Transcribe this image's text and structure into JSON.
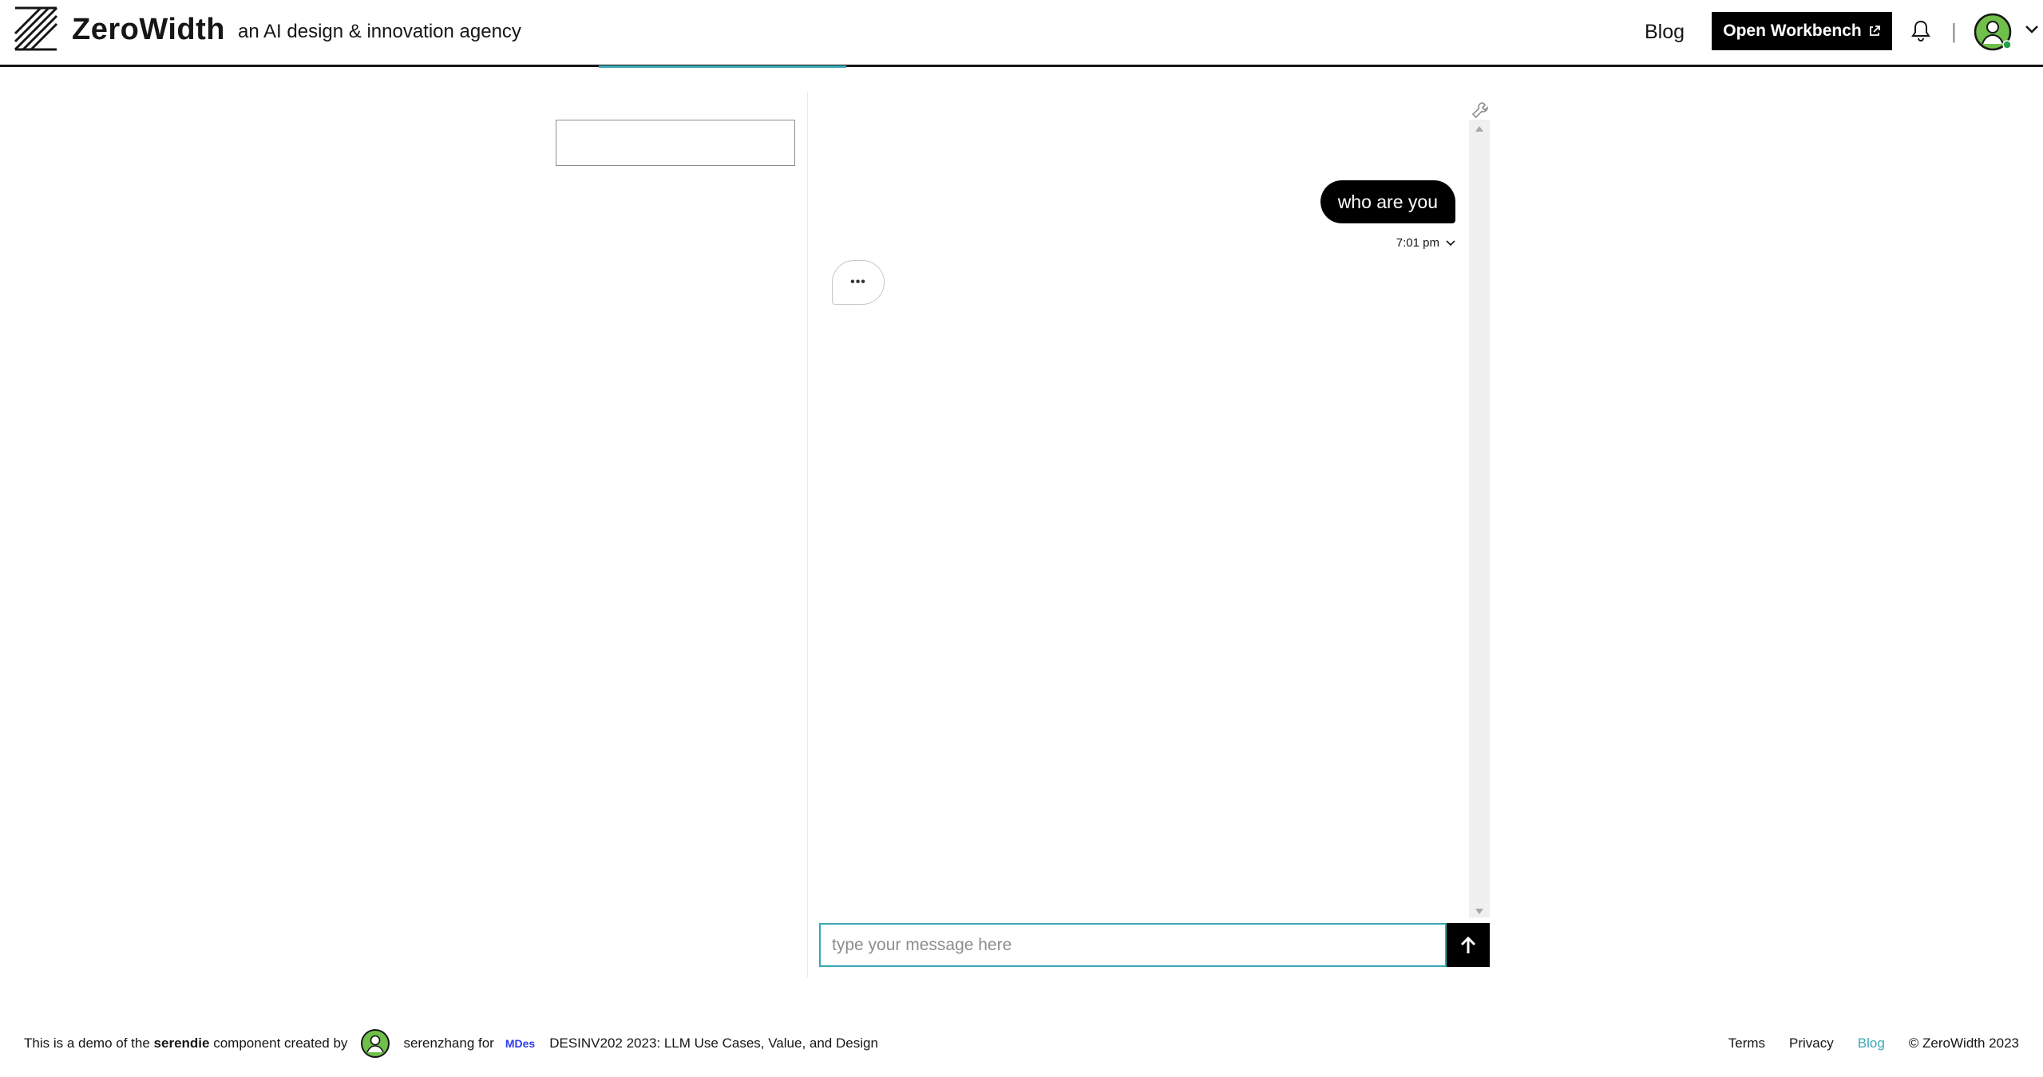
{
  "header": {
    "brand": "ZeroWidth",
    "tagline": "an AI design & innovation agency",
    "nav_blog": "Blog",
    "workbench_label": "Open Workbench",
    "separator": "|"
  },
  "chat": {
    "messages": [
      {
        "role": "user",
        "text": "who are you",
        "time": "7:01 pm"
      }
    ],
    "typing_indicator": "•••",
    "input_placeholder": "type your message here"
  },
  "footer": {
    "intro": "This is a demo of the",
    "component_name": "serendie",
    "created_by": "component created by",
    "author": "serenzhang for",
    "org_badge": "MDes",
    "course": "DESINV202 2023: LLM Use Cases, Value, and Design",
    "links": {
      "terms": "Terms",
      "privacy": "Privacy",
      "blog": "Blog"
    },
    "copyright": "© ZeroWidth 2023"
  },
  "colors": {
    "accent": "#3aa7b5",
    "mdes": "#2d3bf0",
    "online": "#24a148",
    "avatar_bg": "#6fbf4a"
  }
}
